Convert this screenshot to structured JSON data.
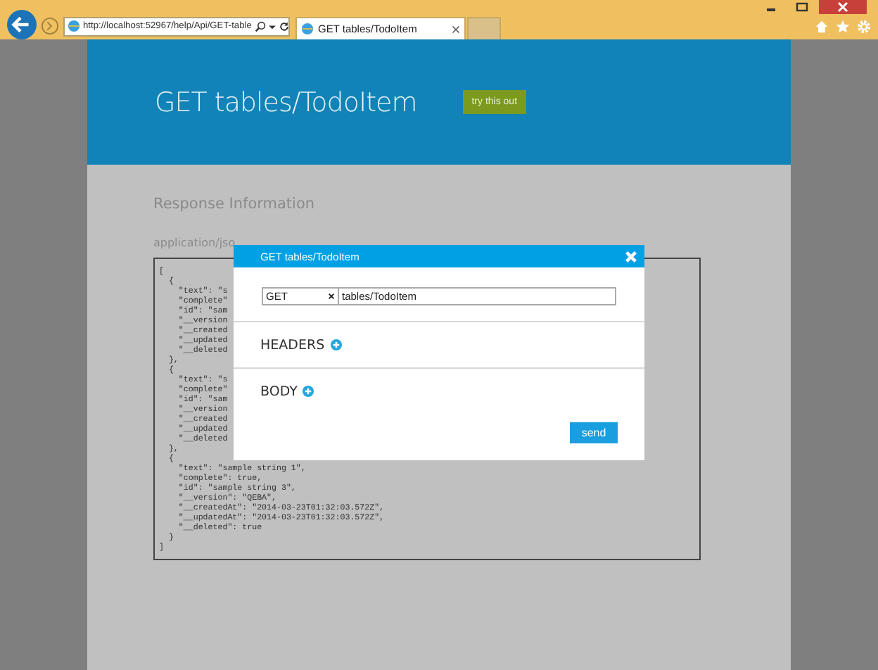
{
  "browser": {
    "url": "http://localhost:52967/help/Api/GET-table",
    "tab": {
      "title": "GET tables/TodoItem",
      "selected": true
    }
  },
  "page": {
    "title": "GET tables/TodoItem",
    "try_button": "try this out",
    "section_heading": "Response Information",
    "media_type": "application/jso",
    "code_lines": [
      "[",
      "  {",
      "    \"text\": \"s",
      "    \"complete\"",
      "    \"id\": \"sam",
      "    \"__version",
      "    \"__created",
      "    \"__updated",
      "    \"__deleted",
      "  },",
      "  {",
      "    \"text\": \"s",
      "    \"complete\"",
      "    \"id\": \"sam",
      "    \"__version",
      "    \"__created",
      "    \"__updated",
      "    \"__deleted",
      "  },",
      "  {",
      "    \"text\": \"sample string 1\",",
      "    \"complete\": true,",
      "    \"id\": \"sample string 3\",",
      "    \"__version\": \"QEBA\",",
      "    \"__createdAt\": \"2014-03-23T01:32:03.572Z\",",
      "    \"__updatedAt\": \"2014-03-23T01:32:03.572Z\",",
      "    \"__deleted\": true",
      "  }",
      "]"
    ]
  },
  "modal": {
    "title": "GET tables/TodoItem",
    "method": "GET",
    "path": "tables/TodoItem",
    "sections": [
      {
        "label": "HEADERS"
      },
      {
        "label": "BODY"
      }
    ],
    "send": "send"
  }
}
